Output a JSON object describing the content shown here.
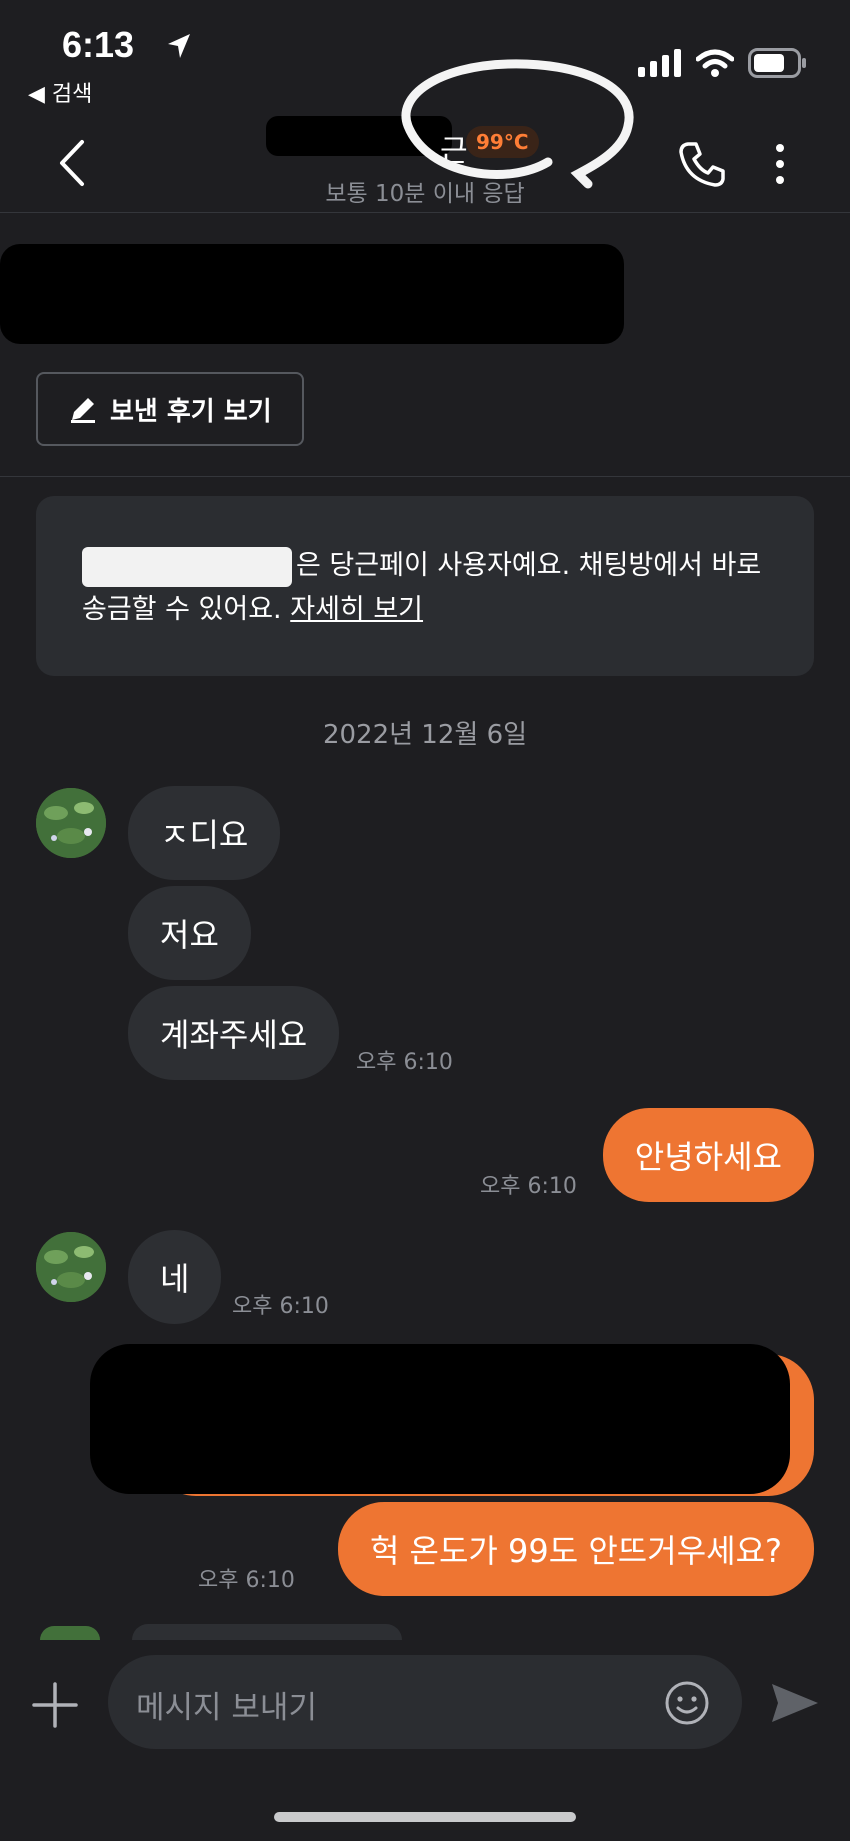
{
  "status_bar": {
    "time": "6:13",
    "back_app": "◀ 검색"
  },
  "header": {
    "title_visible": "근",
    "temperature": "99°C",
    "subtitle": "보통 10분 이내 응답"
  },
  "review_button": {
    "label": "보낸 후기 보기"
  },
  "info": {
    "text": "은 당근페이 사용자예요. 채팅방에서 바로 송금할 수 있어요.",
    "link": "자세히 보기"
  },
  "date_divider": "2022년 12월 6일",
  "messages": [
    {
      "from": "them",
      "text": "ㅈ디요"
    },
    {
      "from": "them",
      "text": "저요"
    },
    {
      "from": "them",
      "text": "계좌주세요",
      "time": "오후 6:10"
    },
    {
      "from": "me",
      "text": "안녕하세요",
      "time": "오후 6:10"
    },
    {
      "from": "them",
      "text": "네",
      "time": "오후 6:10"
    },
    {
      "from": "me",
      "text": "헉 온도가 99도 안뜨거우세요?",
      "time": "오후 6:10"
    }
  ],
  "composer": {
    "placeholder": "메시지 보내기"
  },
  "colors": {
    "accent": "#ee7532",
    "temperature": "#ff7e36",
    "background": "#1e1e21"
  }
}
